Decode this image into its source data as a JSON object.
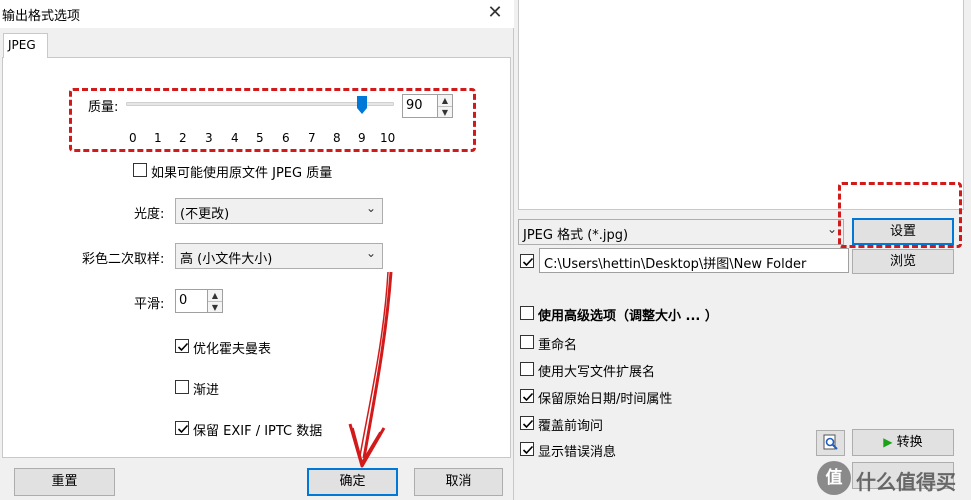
{
  "dialog": {
    "title": "输出格式选项",
    "tab_label": "JPEG",
    "quality_label": "质量:",
    "quality_value": "90",
    "quality_level": 9,
    "quality_ticks": [
      "0",
      "1",
      "2",
      "3",
      "4",
      "5",
      "6",
      "7",
      "8",
      "9",
      "10"
    ],
    "use_original_quality_label": "如果可能使用原文件 JPEG 质量",
    "use_original_quality_checked": false,
    "luminance_label": "光度:",
    "luminance_value": "(不更改)",
    "chroma_label": "彩色二次取样:",
    "chroma_value": "高 (小文件大小)",
    "smoothing_label": "平滑:",
    "smoothing_value": "0",
    "optimize_huffman_label": "优化霍夫曼表",
    "optimize_huffman_checked": true,
    "progressive_label": "渐进",
    "progressive_checked": false,
    "keep_exif_label": "保留 EXIF / IPTC 数据",
    "keep_exif_checked": true,
    "reset_button": "重置",
    "ok_button": "确定",
    "cancel_button": "取消"
  },
  "right_panel": {
    "format_value": "JPEG 格式 (*.jpg)",
    "settings_button": "设置",
    "output_dir_checked": true,
    "output_path": "C:\\Users\\hettin\\Desktop\\拼图\\New Folder",
    "browse_button": "浏览",
    "advanced_label": "使用高级选项（调整大小 ... ）",
    "options": [
      {
        "label": "重命名",
        "checked": false
      },
      {
        "label": "使用大写文件扩展名",
        "checked": false
      },
      {
        "label": "保留原始日期/时间属性",
        "checked": true
      },
      {
        "label": "覆盖前询问",
        "checked": true
      },
      {
        "label": "显示错误消息",
        "checked": true
      }
    ],
    "convert_button": "转换"
  },
  "watermark": {
    "text": "什么值得买",
    "logo_glyph": "值"
  },
  "colors": {
    "annotation_red": "#d21a1a",
    "accent_blue": "#0078d7",
    "convert_green": "#1aa31a"
  }
}
